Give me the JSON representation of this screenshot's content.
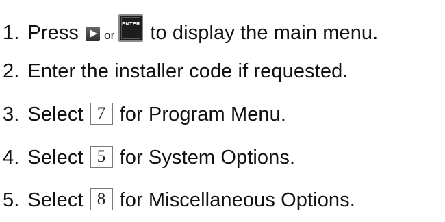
{
  "steps": [
    {
      "number": "1.",
      "before": "Press",
      "or": "or",
      "enter_label": "ENTER",
      "after": "to display the main menu.",
      "icons": [
        "right-arrow-key-icon",
        "enter-key-icon"
      ]
    },
    {
      "number": "2.",
      "text": "Enter the installer code if requested."
    },
    {
      "number": "3.",
      "before": "Select",
      "key": "7",
      "after": "for Program Menu."
    },
    {
      "number": "4.",
      "before": "Select",
      "key": "5",
      "after": "for System Options."
    },
    {
      "number": "5.",
      "before": "Select",
      "key": "8",
      "after": "for Miscellaneous Options."
    }
  ]
}
